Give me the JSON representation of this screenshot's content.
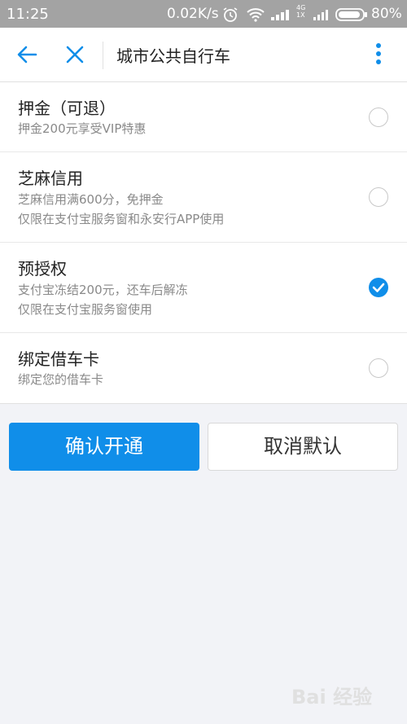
{
  "status_bar": {
    "time": "11:25",
    "speed": "0.02K/s",
    "network_top": "4G",
    "network_bottom": "1X",
    "battery_pct": "80%",
    "icons": [
      "alarm-icon",
      "wifi-icon",
      "signal-icon",
      "signal-icon",
      "battery-icon"
    ]
  },
  "app_bar": {
    "title": "城市公共自行车",
    "icons": [
      "back-arrow-icon",
      "close-icon",
      "more-vertical-icon"
    ],
    "accent_color": "#108ee9"
  },
  "options": [
    {
      "title": "押金（可退）",
      "desc": [
        "押金200元享受VIP特惠"
      ],
      "selected": false
    },
    {
      "title": "芝麻信用",
      "desc": [
        "芝麻信用满600分，免押金",
        "仅限在支付宝服务窗和永安行APP使用"
      ],
      "selected": false
    },
    {
      "title": "预授权",
      "desc": [
        "支付宝冻结200元，还车后解冻",
        "仅限在支付宝服务窗使用"
      ],
      "selected": true
    },
    {
      "title": "绑定借车卡",
      "desc": [
        "绑定您的借车卡"
      ],
      "selected": false
    }
  ],
  "buttons": {
    "confirm_label": "确认开通",
    "cancel_label": "取消默认",
    "confirm_color": "#108ee9"
  },
  "watermark": "Bai 经验"
}
